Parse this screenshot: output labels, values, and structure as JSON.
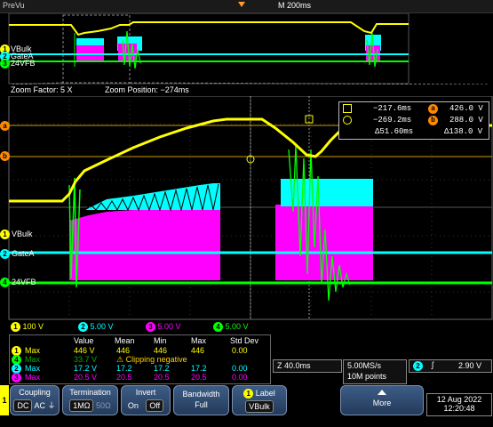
{
  "header": {
    "title": "PreVu",
    "timebase": "M 200ms"
  },
  "preview": {
    "channel_labels": [
      "VBulk",
      "GateA",
      "24VFB"
    ],
    "badges": [
      "1",
      "2",
      "3"
    ]
  },
  "zoom": {
    "factor_label": "Zoom Factor: 5 X",
    "position_label": "Zoom Position: −274ms"
  },
  "cursors": {
    "t1": "−217.6ms",
    "t2": "−269.2ms",
    "dt": "Δ51.60ms",
    "v1": "426.0 V",
    "v2": "288.0 V",
    "dv": "Δ138.0 V",
    "markers": [
      "a",
      "b"
    ]
  },
  "channel_labels": {
    "ch1": "VBulk",
    "ch2": "GateA",
    "ch4": "24VFB"
  },
  "channel_scales": [
    {
      "num": "1",
      "value": "100 V",
      "color": "#ffff00"
    },
    {
      "num": "2",
      "value": "5.00 V",
      "color": "#00ffff"
    },
    {
      "num": "3",
      "value": "5.00 V",
      "color": "#ff00ff"
    },
    {
      "num": "4",
      "value": "5.00 V",
      "color": "#00ff00"
    }
  ],
  "measurements": {
    "headers": [
      "Value",
      "Mean",
      "Min",
      "Max",
      "Std Dev"
    ],
    "rows": [
      {
        "ch": "1",
        "name": "Max",
        "value": "446 V",
        "mean": "446",
        "min": "446",
        "max": "446",
        "std": "0.00",
        "color": "#ffff00"
      },
      {
        "ch": "4",
        "name": "Max",
        "value": "33.7 V",
        "mean": "⚠ Clipping negative",
        "min": "",
        "max": "",
        "std": "",
        "color": "#00ff00"
      },
      {
        "ch": "2",
        "name": "Max",
        "value": "17.2 V",
        "mean": "17.2",
        "min": "17.2",
        "max": "17.2",
        "std": "0.00",
        "color": "#00ffff"
      },
      {
        "ch": "3",
        "name": "Max",
        "value": "20.5 V",
        "mean": "20.5",
        "min": "20.5",
        "max": "20.5",
        "std": "0.00",
        "color": "#ff00ff"
      }
    ]
  },
  "timebase": {
    "zoom": "Z 40.0ms",
    "rate": "5.00MS/s",
    "points": "10M points"
  },
  "trigger": {
    "channel": "2",
    "level": "2.90 V"
  },
  "softkeys": {
    "coupling": {
      "title": "Coupling",
      "options": [
        "DC",
        "AC",
        "⏚"
      ]
    },
    "termination": {
      "title": "Termination",
      "options": [
        "1MΩ",
        "50Ω"
      ]
    },
    "invert": {
      "title": "Invert",
      "options": [
        "On",
        "Off"
      ]
    },
    "bandwidth": {
      "title": "Bandwidth",
      "value": "Full"
    },
    "label": {
      "title": "Label",
      "value": "VBulk",
      "badge": "1"
    },
    "more": "More",
    "side_badge": "1"
  },
  "datetime": {
    "date": "12 Aug 2022",
    "time": "12:20:48"
  }
}
